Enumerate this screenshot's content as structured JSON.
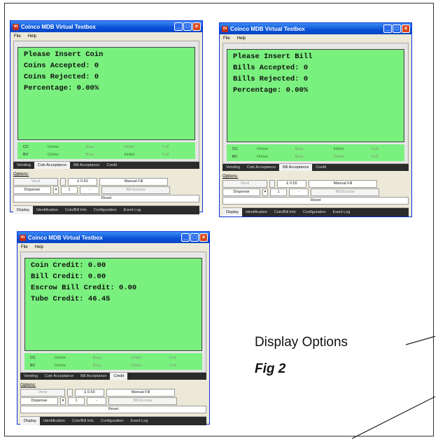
{
  "app_title": "Coinco MDB Virtual Testbox",
  "menu": [
    "File",
    "Help"
  ],
  "status_labels": [
    "CC",
    "BV"
  ],
  "status_words": [
    "Online",
    "Busy",
    "Inhibit",
    "Full"
  ],
  "windows": [
    {
      "lcd": [
        "Please Insert Coin",
        "Coins Accepted: 0",
        "Coins Rejected: 0",
        "Percentage: 0.00%"
      ],
      "active_tab": 1
    },
    {
      "lcd": [
        "Please Insert Bill",
        "Bills Accepted: 0",
        "Bills Rejected: 0",
        "Percentage: 0.00%"
      ],
      "active_tab": 2
    },
    {
      "lcd": [
        "Coin Credit: 0.00",
        "Bill Credit: 0.00",
        "Escrow Bill Credit: 0.00",
        "Tube Credit: 46.45"
      ],
      "active_tab": 3
    }
  ],
  "tabs": [
    "Vending",
    "Coin Acceptance",
    "Bill Acceptance",
    "Credit"
  ],
  "options": {
    "label": "Options:",
    "vend": "Vend",
    "price": "£ 0.50",
    "manual_fill": "Manual Fill",
    "dispense": "Dispense",
    "qty": "1",
    "dash": "-",
    "bill_escrow": "Bill Escrow",
    "reset": "Reset"
  },
  "bottom_tabs": [
    "Display",
    "Identification",
    "Coin/Bill Info",
    "Configuration",
    "Event Log"
  ],
  "caption": "Display Options",
  "figure": "Fig 2"
}
